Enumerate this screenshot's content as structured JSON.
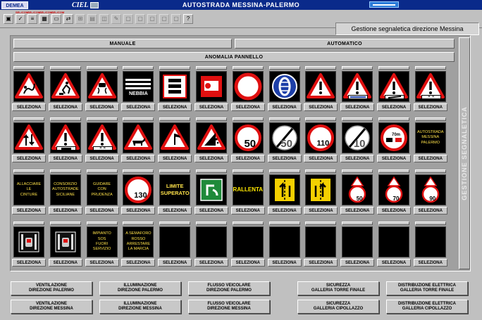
{
  "titlebar": {
    "logo": "DEMEA",
    "app": "CIEL",
    "title": "AUTOSTRADA MESSINA-PALERMO"
  },
  "toolbar": {
    "tools": [
      {
        "icon": "monitor-icon",
        "glyph": "▣",
        "caption": ""
      },
      {
        "icon": "check-icon",
        "glyph": "✓",
        "caption": "SEL/COM"
      },
      {
        "icon": "list-icon",
        "glyph": "≡",
        "caption": "SEL/COM"
      },
      {
        "icon": "calendar-icon",
        "glyph": "▦",
        "caption": "SEL/COM"
      },
      {
        "icon": "folder-icon",
        "glyph": "▭",
        "caption": "SEL/COM"
      },
      {
        "icon": "exchange-icon",
        "glyph": "⇄",
        "caption": ""
      },
      {
        "icon": "network-icon",
        "glyph": "⊞",
        "caption": ""
      },
      {
        "icon": "grid-icon",
        "glyph": "▤",
        "caption": ""
      },
      {
        "icon": "chart-icon",
        "glyph": "◫",
        "caption": ""
      },
      {
        "icon": "tools-icon",
        "glyph": "✎",
        "caption": ""
      },
      {
        "icon": "display-icon",
        "glyph": "▢",
        "caption": ""
      },
      {
        "icon": "box-icon",
        "glyph": "▢",
        "caption": ""
      },
      {
        "icon": "box2-icon",
        "glyph": "▢",
        "caption": ""
      },
      {
        "icon": "box3-icon",
        "glyph": "▢",
        "caption": ""
      },
      {
        "icon": "box4-icon",
        "glyph": "▢",
        "caption": ""
      },
      {
        "icon": "help-icon",
        "glyph": "?",
        "caption": ""
      }
    ],
    "header": "Gestione segnaletica direzione Messina"
  },
  "panel": {
    "manuale": "MANUALE",
    "automatico": "AUTOMATICO",
    "anomalia": "ANOMALIA PANNELLO",
    "side_label": "GESTIONE SEGNALETICA",
    "select_label": "SELEZIONA",
    "signs": [
      {
        "kind": "triangle",
        "sym": "slip"
      },
      {
        "kind": "triangle",
        "sym": "works"
      },
      {
        "kind": "triangle",
        "sym": "skid"
      },
      {
        "kind": "nebbia",
        "text": "NEBBIA"
      },
      {
        "kind": "queue"
      },
      {
        "kind": "redsq"
      },
      {
        "kind": "noentry"
      },
      {
        "kind": "chains"
      },
      {
        "kind": "triangle",
        "sym": "excl"
      },
      {
        "kind": "triangle",
        "sym": "excl",
        "plate": "bluebar"
      },
      {
        "kind": "triangle",
        "sym": "excl",
        "plate": "ramp"
      },
      {
        "kind": "triangle",
        "sym": "excl",
        "plate": "icons"
      },
      {
        "kind": "triangle",
        "sym": "twoway"
      },
      {
        "kind": "triangle",
        "sym": "excl",
        "plate": "truck"
      },
      {
        "kind": "triangle",
        "sym": "excl",
        "plate": "icons"
      },
      {
        "kind": "triangle",
        "sym": "animal"
      },
      {
        "kind": "triangle",
        "sym": "wind"
      },
      {
        "kind": "triangle",
        "sym": "rocks"
      },
      {
        "kind": "speed",
        "value": "50"
      },
      {
        "kind": "endlimit",
        "value": "50"
      },
      {
        "kind": "speed",
        "value": "110"
      },
      {
        "kind": "endlimit",
        "value": "10"
      },
      {
        "kind": "noovertake",
        "value": "70m"
      },
      {
        "kind": "text",
        "lines": [
          "AUTOSTRADA",
          "MESSINA",
          "PALERMO"
        ]
      },
      {
        "kind": "text",
        "lines": [
          "ALLACCIARE",
          "LE",
          "CINTURE"
        ]
      },
      {
        "kind": "text",
        "lines": [
          "CONSORZIO",
          "AUTOSTRADE",
          "SICILIANE"
        ]
      },
      {
        "kind": "text",
        "lines": [
          "GUIDARE",
          "CON",
          "PRUDENZA"
        ]
      },
      {
        "kind": "speed",
        "value": "130"
      },
      {
        "kind": "textbig",
        "lines": [
          "LIMITE",
          "SUPERATO"
        ]
      },
      {
        "kind": "exitgreen"
      },
      {
        "kind": "textyel",
        "lines": [
          "RALLENTA"
        ]
      },
      {
        "kind": "lanes",
        "v": "left"
      },
      {
        "kind": "lanes",
        "v": "right"
      },
      {
        "kind": "smallspeed",
        "value": "50"
      },
      {
        "kind": "smallspeed",
        "value": "70"
      },
      {
        "kind": "smallspeed",
        "value": "90"
      },
      {
        "kind": "lanesignal",
        "v": "a"
      },
      {
        "kind": "lanesignal",
        "v": "b"
      },
      {
        "kind": "text",
        "lines": [
          "IMPIANTO",
          "SOS",
          "FUORI",
          "SERVIZIO"
        ]
      },
      {
        "kind": "text",
        "lines": [
          "A SEMAFORO",
          "ROSSO",
          "ARRESTARE",
          "LA MARCIA"
        ]
      },
      {
        "kind": "blank"
      },
      {
        "kind": "blank"
      },
      {
        "kind": "blank"
      },
      {
        "kind": "blank"
      },
      {
        "kind": "blank"
      },
      {
        "kind": "blank"
      },
      {
        "kind": "blank"
      },
      {
        "kind": "blank"
      }
    ]
  },
  "nav": [
    {
      "l1": "VENTILAZIONE",
      "l2": "DIREZIONE PALERMO"
    },
    {
      "l1": "ILLUMINAZIONE",
      "l2": "DIREZIONE PALERMO"
    },
    {
      "l1": "FLUSSO VEICOLARE",
      "l2": "DIREZIONE PALERMO"
    },
    {
      "l1": "SICUREZZA",
      "l2": "GALLERIA TORRE FINALE"
    },
    {
      "l1": "DISTRIBUZIONE ELETTRICA",
      "l2": "GALLERIA TORRE FINALE"
    },
    {
      "l1": "VENTILAZIONE",
      "l2": "DIREZIONE MESSINA"
    },
    {
      "l1": "ILLUMINAZIONE",
      "l2": "DIREZIONE MESSINA"
    },
    {
      "l1": "FLUSSO VEICOLARE",
      "l2": "DIREZIONE MESSINA"
    },
    {
      "l1": "SICUREZZA",
      "l2": "GALLERIA CIPOLLAZZO"
    },
    {
      "l1": "DISTRIBUZIONE ELETTRICA",
      "l2": "GALLERIA CIPOLLAZZO"
    }
  ],
  "colors": {
    "red": "#e01010",
    "blue": "#1d3fa8",
    "yellow": "#ffe24a",
    "green": "#1f8a3a"
  }
}
